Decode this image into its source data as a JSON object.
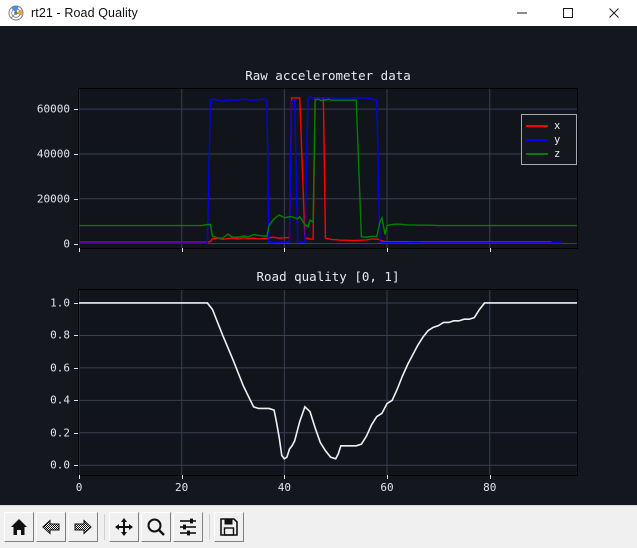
{
  "window": {
    "title": "rt21 - Road Quality",
    "app_icon": "matplotlib-icon",
    "controls": [
      {
        "name": "minimize-button",
        "icon": "minimize-icon",
        "label": "—"
      },
      {
        "name": "maximize-button",
        "icon": "maximize-icon",
        "label": "□"
      },
      {
        "name": "close-button",
        "icon": "close-icon",
        "label": "✕"
      }
    ]
  },
  "figure": {
    "background": "#15171f",
    "axes_background": "#12141c",
    "grid_color": "#3a3f52",
    "text_color": "#e9e9ef"
  },
  "legend": {
    "position": "upper right",
    "entries": [
      {
        "label": "x",
        "color": "#ff0000"
      },
      {
        "label": "y",
        "color": "#0000ff"
      },
      {
        "label": "z",
        "color": "#008000"
      }
    ]
  },
  "toolbar": {
    "buttons": [
      {
        "name": "home-button",
        "icon": "home-icon",
        "tooltip": "Reset original view"
      },
      {
        "name": "back-button",
        "icon": "arrow-left-icon",
        "tooltip": "Back to previous view"
      },
      {
        "name": "forward-button",
        "icon": "arrow-right-icon",
        "tooltip": "Forward to next view"
      },
      {
        "name": "pan-button",
        "icon": "move-icon",
        "tooltip": "Pan axes with left mouse, zoom with right"
      },
      {
        "name": "zoom-button",
        "icon": "magnifier-icon",
        "tooltip": "Zoom to rectangle"
      },
      {
        "name": "configure-subplots-button",
        "icon": "sliders-icon",
        "tooltip": "Configure subplots"
      },
      {
        "name": "save-button",
        "icon": "floppy-disk-icon",
        "tooltip": "Save the figure"
      }
    ]
  },
  "chart_data": [
    {
      "type": "line",
      "id": "raw-accelerometer",
      "title": "Raw accelerometer data",
      "xlabel": "",
      "ylabel": "",
      "xlim": [
        0,
        97
      ],
      "ylim": [
        -2000,
        69000
      ],
      "grid": true,
      "yticks": [
        0,
        20000,
        40000,
        60000
      ],
      "ytick_labels": [
        "0",
        "20000",
        "40000",
        "60000"
      ],
      "xticks": [
        0,
        20,
        40,
        60,
        80
      ],
      "xtick_labels_visible": false,
      "legend": [
        "x",
        "y",
        "z"
      ],
      "x": [
        0,
        1,
        2,
        3,
        4,
        5,
        6,
        7,
        8,
        9,
        10,
        11,
        12,
        13,
        14,
        15,
        16,
        17,
        18,
        19,
        20,
        21,
        22,
        23,
        24,
        25,
        25.6,
        26,
        27,
        28,
        29,
        30,
        31,
        32,
        33,
        34,
        35,
        36,
        36.6,
        37,
        38,
        39,
        40,
        41,
        41.4,
        42,
        42.6,
        43,
        44,
        44.6,
        45,
        45.6,
        46,
        46.6,
        47,
        47.6,
        48,
        48.6,
        49,
        50,
        51,
        52,
        53,
        54,
        55,
        56,
        57,
        58,
        58.6,
        59,
        59.6,
        60,
        61,
        62,
        63,
        64,
        65,
        66,
        67,
        68,
        70,
        72,
        74,
        76,
        78,
        80,
        82,
        84,
        86,
        88,
        90,
        92,
        94,
        96,
        97
      ],
      "series": [
        {
          "name": "x",
          "color": "#ff0000",
          "values": [
            600,
            600,
            600,
            600,
            600,
            600,
            600,
            600,
            600,
            600,
            600,
            600,
            600,
            600,
            600,
            600,
            600,
            600,
            600,
            600,
            600,
            600,
            600,
            600,
            600,
            600,
            900,
            2100,
            2400,
            1900,
            2200,
            2500,
            2000,
            2600,
            2200,
            2400,
            2000,
            2300,
            2300,
            2600,
            2800,
            2400,
            2600,
            2600,
            65000,
            65000,
            65000,
            65000,
            2400,
            2400,
            2000,
            2000,
            65000,
            65000,
            65000,
            65000,
            2400,
            2200,
            1800,
            1700,
            1500,
            1500,
            1400,
            1400,
            1500,
            1600,
            2000,
            2000,
            1700,
            1200,
            900,
            800,
            800,
            800,
            800,
            800,
            700,
            700,
            700,
            700,
            700,
            700,
            700,
            700,
            700,
            700,
            700,
            700,
            700,
            700,
            700,
            700
          ]
        },
        {
          "name": "y",
          "color": "#0000ff",
          "values": [
            200,
            200,
            200,
            200,
            200,
            200,
            200,
            200,
            200,
            200,
            200,
            200,
            200,
            200,
            200,
            200,
            200,
            200,
            200,
            200,
            200,
            200,
            200,
            200,
            200,
            200,
            64000,
            64500,
            64000,
            63500,
            64000,
            64200,
            64000,
            64500,
            64200,
            64000,
            64200,
            64500,
            64000,
            400,
            400,
            500,
            600,
            600,
            63500,
            64000,
            600,
            600,
            600,
            64500,
            65500,
            65000,
            65000,
            65000,
            65000,
            65000,
            65000,
            65000,
            65000,
            65000,
            65000,
            65000,
            65000,
            65000,
            65000,
            65000,
            64500,
            64000,
            600,
            500,
            400,
            400,
            400,
            400,
            400,
            400,
            400,
            400,
            300,
            300,
            300,
            300,
            300,
            300,
            300,
            300,
            300,
            300,
            300,
            300,
            300,
            300,
            300
          ]
        },
        {
          "name": "z",
          "color": "#008000",
          "values": [
            8000,
            8000,
            8000,
            8000,
            8000,
            8000,
            8000,
            8000,
            8000,
            8000,
            8000,
            8000,
            8000,
            8000,
            8000,
            8000,
            8000,
            8000,
            8000,
            8000,
            8000,
            8000,
            8000,
            8000,
            8000,
            8500,
            8500,
            3200,
            2500,
            2400,
            4200,
            2800,
            2800,
            3400,
            3000,
            4000,
            3600,
            3400,
            3200,
            8000,
            11000,
            12800,
            11500,
            12000,
            12000,
            11500,
            11000,
            12000,
            8500,
            7500,
            10500,
            9500,
            64000,
            64500,
            64000,
            63800,
            64000,
            64500,
            64000,
            64000,
            64000,
            64000,
            64000,
            64000,
            3000,
            2800,
            3200,
            3000,
            9500,
            11500,
            4000,
            8000,
            8500,
            8700,
            8500,
            8300,
            8300,
            8200,
            8200,
            8200,
            8000,
            8000,
            8000,
            8000,
            8000,
            8000,
            8000,
            8000,
            8000,
            8000,
            8000,
            8000,
            8000,
            8000,
            8000
          ]
        }
      ]
    },
    {
      "type": "line",
      "id": "road-quality",
      "title": "Road quality [0, 1]",
      "xlabel": "",
      "ylabel": "",
      "xlim": [
        0,
        97
      ],
      "ylim": [
        -0.06,
        1.08
      ],
      "grid": true,
      "yticks": [
        0.0,
        0.2,
        0.4,
        0.6,
        0.8,
        1.0
      ],
      "ytick_labels": [
        "0.0",
        "0.2",
        "0.4",
        "0.6",
        "0.8",
        "1.0"
      ],
      "xticks": [
        0,
        20,
        40,
        60,
        80
      ],
      "xtick_labels": [
        "0",
        "20",
        "40",
        "60",
        "80"
      ],
      "line_color": "#f0f0f0",
      "x": [
        0,
        5,
        10,
        15,
        20,
        24,
        25,
        26,
        28,
        30,
        32,
        34,
        35,
        36,
        37,
        38,
        38.5,
        39,
        39.5,
        40,
        40.5,
        41,
        41.5,
        42,
        43,
        44,
        45,
        46,
        47,
        48,
        49,
        50,
        50.5,
        51,
        52,
        53,
        54,
        55,
        56,
        57,
        58,
        59,
        60,
        61,
        62,
        63,
        64,
        65,
        66,
        67,
        68,
        69,
        70,
        71,
        72,
        73,
        74,
        75,
        76,
        77,
        78,
        79,
        80,
        85,
        90,
        95,
        97
      ],
      "values": [
        1.0,
        1.0,
        1.0,
        1.0,
        1.0,
        1.0,
        1.0,
        0.96,
        0.8,
        0.65,
        0.49,
        0.36,
        0.35,
        0.35,
        0.35,
        0.34,
        0.26,
        0.17,
        0.06,
        0.04,
        0.05,
        0.1,
        0.12,
        0.15,
        0.27,
        0.36,
        0.33,
        0.23,
        0.14,
        0.09,
        0.05,
        0.04,
        0.07,
        0.12,
        0.12,
        0.12,
        0.12,
        0.13,
        0.18,
        0.25,
        0.3,
        0.32,
        0.38,
        0.4,
        0.47,
        0.55,
        0.62,
        0.68,
        0.74,
        0.79,
        0.83,
        0.85,
        0.86,
        0.88,
        0.88,
        0.89,
        0.89,
        0.9,
        0.9,
        0.91,
        0.96,
        1.0,
        1.0,
        1.0,
        1.0,
        1.0,
        1.0
      ]
    }
  ]
}
